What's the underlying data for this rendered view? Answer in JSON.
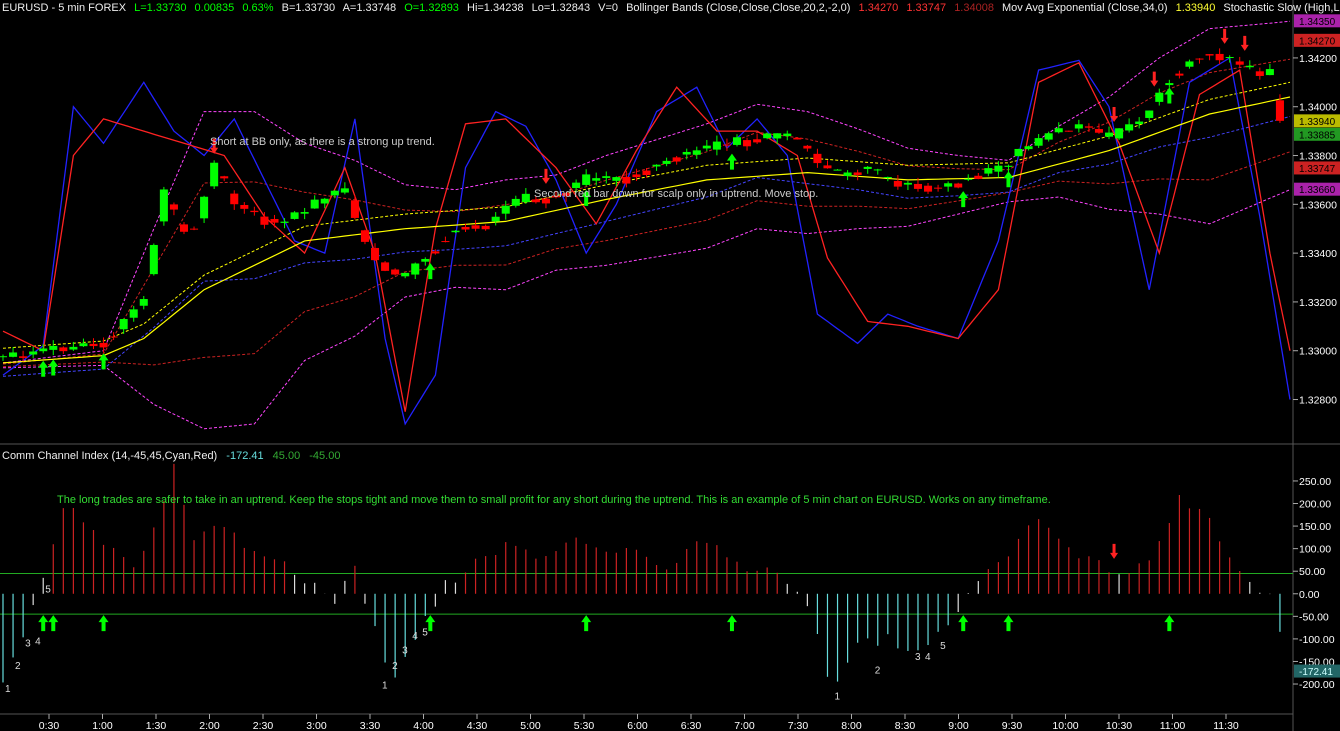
{
  "header": {
    "symbol": "EURUSD - 5 min  FOREX",
    "last": "L=1.33730",
    "change": "0.00835",
    "change_pct": "0.63%",
    "bid": "B=1.33730",
    "ask": "A=1.33748",
    "open": "O=1.32893",
    "high": "Hi=1.34238",
    "low": "Lo=1.32843",
    "volume": "V=0",
    "bb_label": "Bollinger Bands (Close,Close,Close,20,2,-2,0)",
    "bb_v1": "1.34270",
    "bb_v2": "1.33747",
    "bb_v3": "1.34008",
    "ema_label": "Mov Avg Exponential (Close,34,0)",
    "ema_val": "1.33940",
    "stoch_label": "Stochastic Slow (High,L..."
  },
  "cci_header": {
    "label": "Comm Channel Index (14,-45,45,Cyan,Red)",
    "value": "-172.41",
    "upper": "45.00",
    "lower": "-45.00"
  },
  "annotations": {
    "note1": "Short at BB only, as there is a strong up trend.",
    "note2": "Second red bar down for scalp only in uptrend. Move stop.",
    "note3": "The long trades are safer to take in an uptrend. Keep the stops tight and move them to small profit for any short during the uptrend. This is an example of 5 min chart on EURUSD. Works on any timeframe."
  },
  "colors": {
    "background": "#000000",
    "up_candle": "#00ff00",
    "down_candle": "#ff0000",
    "ema": "#ffff00",
    "bb_outer": "#ff44ff",
    "bb_inner": "#cc2222",
    "stoch_k": "#2222ff",
    "stoch_d": "#ff2222",
    "cci_pos": "#cc2222",
    "cci_neg": "#66dddd",
    "axis_text": "#ffffff",
    "note_text": "#cccccc",
    "note3_text": "#33dd33"
  },
  "price_axis": {
    "ticks": [
      "1.34200",
      "1.34000",
      "1.33800",
      "1.33600",
      "1.33400",
      "1.33200",
      "1.33000",
      "1.32800"
    ],
    "tick_values": [
      1.342,
      1.34,
      1.338,
      1.336,
      1.334,
      1.332,
      1.33,
      1.328
    ],
    "range": [
      1.3263,
      1.3438
    ],
    "badges": [
      {
        "text": "1.34350",
        "value": 1.3435,
        "color": "#aa22aa"
      },
      {
        "text": "1.34270",
        "value": 1.3427,
        "color": "#cc2222"
      },
      {
        "text": "1.33940",
        "value": 1.3394,
        "color": "#bbbb00"
      },
      {
        "text": "1.33885",
        "value": 1.33885,
        "color": "#229922"
      },
      {
        "text": "1.33747",
        "value": 1.33747,
        "color": "#cc2222"
      },
      {
        "text": "1.33660",
        "value": 1.3366,
        "color": "#aa22aa"
      }
    ]
  },
  "cci_axis": {
    "ticks": [
      "250.00",
      "200.00",
      "150.00",
      "100.00",
      "50.00",
      "0.00",
      "-50.00",
      "-100.00",
      "-150.00",
      "-200.00"
    ],
    "tick_values": [
      250,
      200,
      150,
      100,
      50,
      0,
      -50,
      -100,
      -150,
      -200
    ],
    "range": [
      -262,
      292
    ],
    "badge": {
      "text": "-172.41",
      "value": -172.41,
      "color": "#226666"
    }
  },
  "time_axis": [
    "0:30",
    "1:00",
    "1:30",
    "2:00",
    "2:30",
    "3:00",
    "3:30",
    "4:00",
    "4:30",
    "5:00",
    "5:30",
    "6:00",
    "6:30",
    "7:00",
    "7:30",
    "8:00",
    "8:30",
    "9:00",
    "9:30",
    "10:00",
    "10:30",
    "11:00",
    "11:30"
  ],
  "cci_counts": [
    {
      "text": "1",
      "bar": 0,
      "value": -195
    },
    {
      "text": "2",
      "bar": 2,
      "value": -145
    },
    {
      "text": "3",
      "bar": 4,
      "value": -95
    },
    {
      "text": "4",
      "bar": 6,
      "value": -90
    },
    {
      "text": "5",
      "bar": 8,
      "value": 25
    },
    {
      "text": "1",
      "bar": 75,
      "value": -188
    },
    {
      "text": "2",
      "bar": 77,
      "value": -145
    },
    {
      "text": "3",
      "bar": 79,
      "value": -110
    },
    {
      "text": "4",
      "bar": 81,
      "value": -78
    },
    {
      "text": "5",
      "bar": 83,
      "value": -70
    },
    {
      "text": "1",
      "bar": 165,
      "value": -212
    },
    {
      "text": "2",
      "bar": 173,
      "value": -155
    },
    {
      "text": "3",
      "bar": 181,
      "value": -125
    },
    {
      "text": "4",
      "bar": 183,
      "value": -125
    },
    {
      "text": "5",
      "bar": 186,
      "value": -100
    }
  ],
  "chart_data": {
    "type": "line",
    "title": "EURUSD - 5 min",
    "candle_count": 256,
    "price_path": [
      [
        0,
        1.3297
      ],
      [
        8,
        1.33
      ],
      [
        20,
        1.3303
      ],
      [
        28,
        1.332
      ],
      [
        32,
        1.3365
      ],
      [
        35,
        1.3352
      ],
      [
        38,
        1.3348
      ],
      [
        42,
        1.3375
      ],
      [
        46,
        1.3362
      ],
      [
        50,
        1.3355
      ],
      [
        56,
        1.3352
      ],
      [
        62,
        1.336
      ],
      [
        68,
        1.3366
      ],
      [
        72,
        1.3345
      ],
      [
        76,
        1.3334
      ],
      [
        80,
        1.333
      ],
      [
        84,
        1.3338
      ],
      [
        90,
        1.335
      ],
      [
        96,
        1.3352
      ],
      [
        100,
        1.3358
      ],
      [
        104,
        1.3362
      ],
      [
        110,
        1.3363
      ],
      [
        116,
        1.337
      ],
      [
        124,
        1.3371
      ],
      [
        132,
        1.3378
      ],
      [
        140,
        1.3383
      ],
      [
        148,
        1.3386
      ],
      [
        154,
        1.3388
      ],
      [
        158,
        1.3386
      ],
      [
        162,
        1.3378
      ],
      [
        166,
        1.3372
      ],
      [
        172,
        1.3375
      ],
      [
        176,
        1.337
      ],
      [
        182,
        1.3368
      ],
      [
        186,
        1.3367
      ],
      [
        192,
        1.337
      ],
      [
        198,
        1.3375
      ],
      [
        204,
        1.3383
      ],
      [
        210,
        1.339
      ],
      [
        216,
        1.3392
      ],
      [
        220,
        1.3387
      ],
      [
        226,
        1.3393
      ],
      [
        232,
        1.3412
      ],
      [
        236,
        1.3418
      ],
      [
        240,
        1.3422
      ],
      [
        246,
        1.3418
      ],
      [
        252,
        1.3413
      ],
      [
        256,
        1.3373
      ]
    ],
    "ema_path": [
      [
        0,
        1.3295
      ],
      [
        20,
        1.3298
      ],
      [
        28,
        1.3305
      ],
      [
        40,
        1.3325
      ],
      [
        60,
        1.3345
      ],
      [
        80,
        1.335
      ],
      [
        100,
        1.3353
      ],
      [
        120,
        1.3362
      ],
      [
        140,
        1.337
      ],
      [
        160,
        1.3373
      ],
      [
        180,
        1.337
      ],
      [
        200,
        1.3371
      ],
      [
        220,
        1.3382
      ],
      [
        240,
        1.3397
      ],
      [
        256,
        1.3404
      ]
    ],
    "bb_upper_path": [
      [
        0,
        1.3295
      ],
      [
        20,
        1.33
      ],
      [
        30,
        1.335
      ],
      [
        40,
        1.3398
      ],
      [
        50,
        1.3398
      ],
      [
        60,
        1.3385
      ],
      [
        70,
        1.3378
      ],
      [
        80,
        1.3368
      ],
      [
        90,
        1.3366
      ],
      [
        100,
        1.337
      ],
      [
        110,
        1.3372
      ],
      [
        120,
        1.338
      ],
      [
        140,
        1.3393
      ],
      [
        150,
        1.3401
      ],
      [
        160,
        1.3398
      ],
      [
        170,
        1.3391
      ],
      [
        180,
        1.3383
      ],
      [
        190,
        1.338
      ],
      [
        200,
        1.3378
      ],
      [
        210,
        1.3392
      ],
      [
        220,
        1.3404
      ],
      [
        230,
        1.342
      ],
      [
        240,
        1.3432
      ],
      [
        256,
        1.3435
      ]
    ],
    "bb_lower_path": [
      [
        0,
        1.3293
      ],
      [
        20,
        1.3294
      ],
      [
        30,
        1.3278
      ],
      [
        40,
        1.3268
      ],
      [
        50,
        1.327
      ],
      [
        60,
        1.3296
      ],
      [
        70,
        1.3306
      ],
      [
        80,
        1.3322
      ],
      [
        90,
        1.3326
      ],
      [
        100,
        1.3325
      ],
      [
        110,
        1.3333
      ],
      [
        120,
        1.3335
      ],
      [
        140,
        1.3342
      ],
      [
        150,
        1.335
      ],
      [
        160,
        1.3348
      ],
      [
        170,
        1.335
      ],
      [
        180,
        1.3351
      ],
      [
        190,
        1.3356
      ],
      [
        200,
        1.3361
      ],
      [
        210,
        1.3363
      ],
      [
        220,
        1.3358
      ],
      [
        230,
        1.3356
      ],
      [
        240,
        1.3352
      ],
      [
        256,
        1.3366
      ]
    ],
    "stoch_k_path": [
      [
        0,
        1.329
      ],
      [
        8,
        1.3302
      ],
      [
        14,
        1.34
      ],
      [
        20,
        1.3385
      ],
      [
        28,
        1.341
      ],
      [
        34,
        1.339
      ],
      [
        40,
        1.338
      ],
      [
        46,
        1.3395
      ],
      [
        52,
        1.337
      ],
      [
        58,
        1.3345
      ],
      [
        64,
        1.334
      ],
      [
        70,
        1.3395
      ],
      [
        76,
        1.3305
      ],
      [
        80,
        1.327
      ],
      [
        86,
        1.329
      ],
      [
        92,
        1.3375
      ],
      [
        98,
        1.3398
      ],
      [
        104,
        1.3392
      ],
      [
        110,
        1.337
      ],
      [
        116,
        1.334
      ],
      [
        122,
        1.336
      ],
      [
        130,
        1.3398
      ],
      [
        138,
        1.3408
      ],
      [
        144,
        1.3383
      ],
      [
        150,
        1.3395
      ],
      [
        156,
        1.338
      ],
      [
        162,
        1.3315
      ],
      [
        170,
        1.3303
      ],
      [
        176,
        1.3315
      ],
      [
        182,
        1.331
      ],
      [
        190,
        1.3305
      ],
      [
        198,
        1.3345
      ],
      [
        206,
        1.3415
      ],
      [
        214,
        1.3419
      ],
      [
        220,
        1.34
      ],
      [
        228,
        1.3325
      ],
      [
        236,
        1.341
      ],
      [
        244,
        1.342
      ],
      [
        250,
        1.3355
      ],
      [
        256,
        1.328
      ]
    ],
    "stoch_d_path": [
      [
        0,
        1.3308
      ],
      [
        8,
        1.33
      ],
      [
        14,
        1.338
      ],
      [
        20,
        1.3395
      ],
      [
        28,
        1.339
      ],
      [
        36,
        1.3385
      ],
      [
        44,
        1.338
      ],
      [
        52,
        1.3355
      ],
      [
        60,
        1.334
      ],
      [
        68,
        1.3375
      ],
      [
        74,
        1.334
      ],
      [
        80,
        1.3275
      ],
      [
        86,
        1.335
      ],
      [
        92,
        1.3393
      ],
      [
        100,
        1.3395
      ],
      [
        110,
        1.3375
      ],
      [
        118,
        1.3352
      ],
      [
        126,
        1.3382
      ],
      [
        134,
        1.3408
      ],
      [
        142,
        1.339
      ],
      [
        150,
        1.339
      ],
      [
        158,
        1.338
      ],
      [
        164,
        1.3338
      ],
      [
        172,
        1.3312
      ],
      [
        180,
        1.331
      ],
      [
        190,
        1.3305
      ],
      [
        198,
        1.3325
      ],
      [
        206,
        1.341
      ],
      [
        214,
        1.3418
      ],
      [
        222,
        1.3385
      ],
      [
        230,
        1.334
      ],
      [
        238,
        1.3405
      ],
      [
        246,
        1.3415
      ],
      [
        252,
        1.334
      ],
      [
        256,
        1.33
      ]
    ],
    "cci_path": [
      [
        0,
        -195
      ],
      [
        4,
        -100
      ],
      [
        8,
        25
      ],
      [
        12,
        200
      ],
      [
        16,
        160
      ],
      [
        20,
        110
      ],
      [
        26,
        60
      ],
      [
        30,
        140
      ],
      [
        34,
        290
      ],
      [
        38,
        120
      ],
      [
        44,
        150
      ],
      [
        50,
        90
      ],
      [
        56,
        60
      ],
      [
        62,
        20
      ],
      [
        66,
        -10
      ],
      [
        70,
        50
      ],
      [
        74,
        -80
      ],
      [
        77,
        -190
      ],
      [
        80,
        -150
      ],
      [
        84,
        -60
      ],
      [
        88,
        20
      ],
      [
        94,
        70
      ],
      [
        100,
        110
      ],
      [
        108,
        80
      ],
      [
        114,
        130
      ],
      [
        120,
        95
      ],
      [
        126,
        100
      ],
      [
        132,
        60
      ],
      [
        140,
        125
      ],
      [
        148,
        60
      ],
      [
        154,
        40
      ],
      [
        160,
        -20
      ],
      [
        165,
        -212
      ],
      [
        170,
        -110
      ],
      [
        176,
        -100
      ],
      [
        182,
        -130
      ],
      [
        188,
        -70
      ],
      [
        194,
        20
      ],
      [
        200,
        95
      ],
      [
        206,
        170
      ],
      [
        212,
        100
      ],
      [
        218,
        70
      ],
      [
        224,
        40
      ],
      [
        228,
        80
      ],
      [
        234,
        210
      ],
      [
        240,
        160
      ],
      [
        246,
        40
      ],
      [
        252,
        0
      ],
      [
        256,
        -172
      ]
    ],
    "up_arrows": [
      8,
      10,
      20,
      85,
      116,
      145,
      191,
      200,
      232
    ],
    "down_arrows": [
      42,
      108,
      221,
      229,
      243,
      247
    ]
  }
}
